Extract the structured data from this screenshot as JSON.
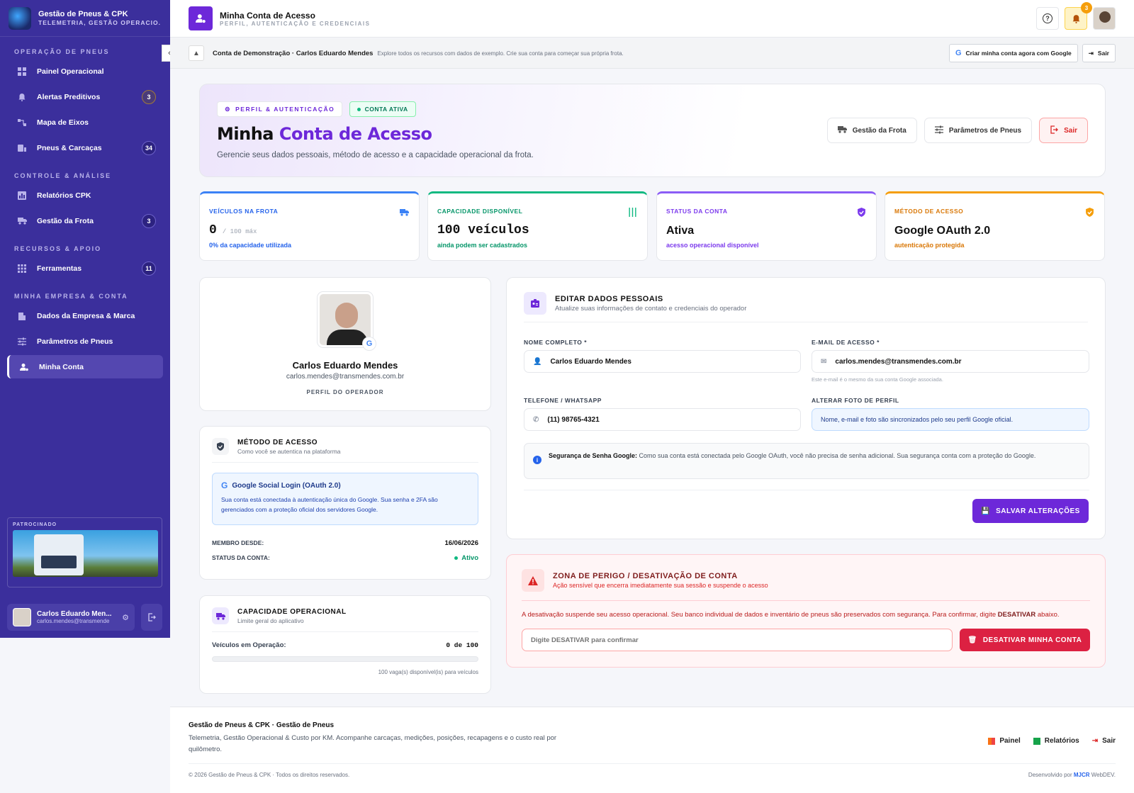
{
  "sidebar": {
    "app_title": "Gestão de Pneus & CPK",
    "app_subtitle": "TELEMETRIA, GESTÃO OPERACIO...",
    "sections": [
      {
        "title": "OPERAÇÃO DE PNEUS"
      },
      {
        "title": "CONTROLE & ANÁLISE"
      },
      {
        "title": "RECURSOS & APOIO"
      },
      {
        "title": "MINHA EMPRESA & CONTA"
      }
    ],
    "items": [
      {
        "label": "Painel Operacional",
        "icon": "dashboard-icon"
      },
      {
        "label": "Alertas Preditivos",
        "icon": "bell-icon",
        "count": "3"
      },
      {
        "label": "Mapa de Eixos",
        "icon": "axles-icon"
      },
      {
        "label": "Pneus & Carcaças",
        "icon": "tire-icon",
        "count": "34"
      },
      {
        "label": "Relatórios CPK",
        "icon": "report-icon"
      },
      {
        "label": "Gestão da Frota",
        "icon": "truck-icon",
        "count": "3"
      },
      {
        "label": "Ferramentas",
        "icon": "grid-icon",
        "count": "11"
      },
      {
        "label": "Dados da Empresa & Marca",
        "icon": "building-icon"
      },
      {
        "label": "Parâmetros de Pneus",
        "icon": "sliders-icon"
      },
      {
        "label": "Minha Conta",
        "icon": "user-gear-icon"
      }
    ],
    "sponsor_label": "PATROCINADO",
    "user_name": "Carlos Eduardo Men...",
    "user_email": "carlos.mendes@transmende"
  },
  "topbar": {
    "title": "Minha Conta de Acesso",
    "subtitle": "PERFIL, AUTENTICAÇÃO E CREDENCIAIS",
    "notifications": "3"
  },
  "demo": {
    "title": "Conta de Demonstração · Carlos Eduardo Mendes",
    "text": "Explore todos os recursos com dados de exemplo. Crie sua conta para começar sua própria frota.",
    "google_btn": "Criar minha conta agora com Google",
    "logout_btn": "Sair"
  },
  "hero": {
    "pill_profile": "PERFIL & AUTENTICAÇÃO",
    "pill_status": "CONTA ATIVA",
    "title_a": "Minha ",
    "title_b": "Conta de Acesso",
    "desc": "Gerencie seus dados pessoais, método de acesso e a capacidade operacional da frota.",
    "btn_fleet": "Gestão da Frota",
    "btn_params": "Parâmetros de Pneus",
    "btn_logout": "Sair"
  },
  "stats": [
    {
      "label": "VEÍCULOS NA FROTA",
      "value": "0",
      "extra": "/ 100 máx",
      "sub": "0% da capacidade utilizada",
      "color": "#2563eb"
    },
    {
      "label": "CAPACIDADE DISPONÍVEL",
      "value": "100 veículos",
      "extra": "",
      "sub": "ainda podem ser cadastrados",
      "color": "#059669"
    },
    {
      "label": "STATUS DA CONTA",
      "value": "Ativa",
      "extra": "",
      "sub": "acesso operacional disponível",
      "color": "#7c3aed"
    },
    {
      "label": "MÉTODO DE ACESSO",
      "value": "Google OAuth 2.0",
      "extra": "",
      "sub": "autenticação protegida",
      "color": "#d97706"
    }
  ],
  "profile": {
    "name": "Carlos Eduardo Mendes",
    "email": "carlos.mendes@transmendes.com.br",
    "role": "PERFIL DO OPERADOR"
  },
  "access": {
    "title": "MÉTODO DE ACESSO",
    "subtitle": "Como você se autentica na plataforma",
    "box_title": "Google Social Login (OAuth 2.0)",
    "box_text": "Sua conta está conectada à autenticação única do Google. Sua senha e 2FA são gerenciados com a proteção oficial dos servidores Google.",
    "member_label": "MEMBRO DESDE:",
    "member_value": "16/06/2026",
    "status_label": "STATUS DA CONTA:",
    "status_value": "Ativo"
  },
  "capacity": {
    "title": "CAPACIDADE OPERACIONAL",
    "subtitle": "Limite geral do aplicativo",
    "label": "Veículos em Operação:",
    "value": "0 de 100",
    "progress": 0,
    "footnote": "100 vaga(s) disponível(is) para veículos"
  },
  "edit": {
    "title": "EDITAR DADOS PESSOAIS",
    "subtitle": "Atualize suas informações de contato e credenciais do operador",
    "name_label": "NOME COMPLETO *",
    "name_value": "Carlos Eduardo Mendes",
    "email_label": "E-MAIL DE ACESSO *",
    "email_value": "carlos.mendes@transmendes.com.br",
    "email_hint": "Este e-mail é o mesmo da sua conta Google associada.",
    "phone_label": "TELEFONE / WHATSAPP",
    "phone_value": "(11) 98765-4321",
    "photo_label": "ALTERAR FOTO DE PERFIL",
    "photo_text": "Nome, e-mail e foto são sincronizados pelo seu perfil Google oficial.",
    "security_bold": "Segurança de Senha Google:",
    "security_text": " Como sua conta está conectada pelo Google OAuth, você não precisa de senha adicional. Sua segurança conta com a proteção do Google.",
    "save": "SALVAR ALTERAÇÕES"
  },
  "danger": {
    "title": "ZONA DE PERIGO / DESATIVAÇÃO DE CONTA",
    "subtitle": "Ação sensível que encerra imediatamente sua sessão e suspende o acesso",
    "text": "A desativação suspende seu acesso operacional. Seu banco individual de dados e inventário de pneus são preservados com segurança. Para confirmar, digite ",
    "keyword": "DESATIVAR",
    "text_end": " abaixo.",
    "placeholder": "Digite DESATIVAR para confirmar",
    "button": "DESATIVAR MINHA CONTA"
  },
  "footer": {
    "title": "Gestão de Pneus & CPK · Gestão de Pneus",
    "desc": "Telemetria, Gestão Operacional & Custo por KM. Acompanhe carcaças, medições, posições, recapagens e o custo real por quilômetro.",
    "link_panel": "Painel",
    "link_reports": "Relatórios",
    "link_logout": "Sair",
    "copyright": "© 2026 Gestão de Pneus & CPK · Todos os direitos reservados.",
    "dev_prefix": "Desenvolvido por ",
    "dev_brand": "MJCR",
    "dev_suffix": " WebDEV."
  }
}
